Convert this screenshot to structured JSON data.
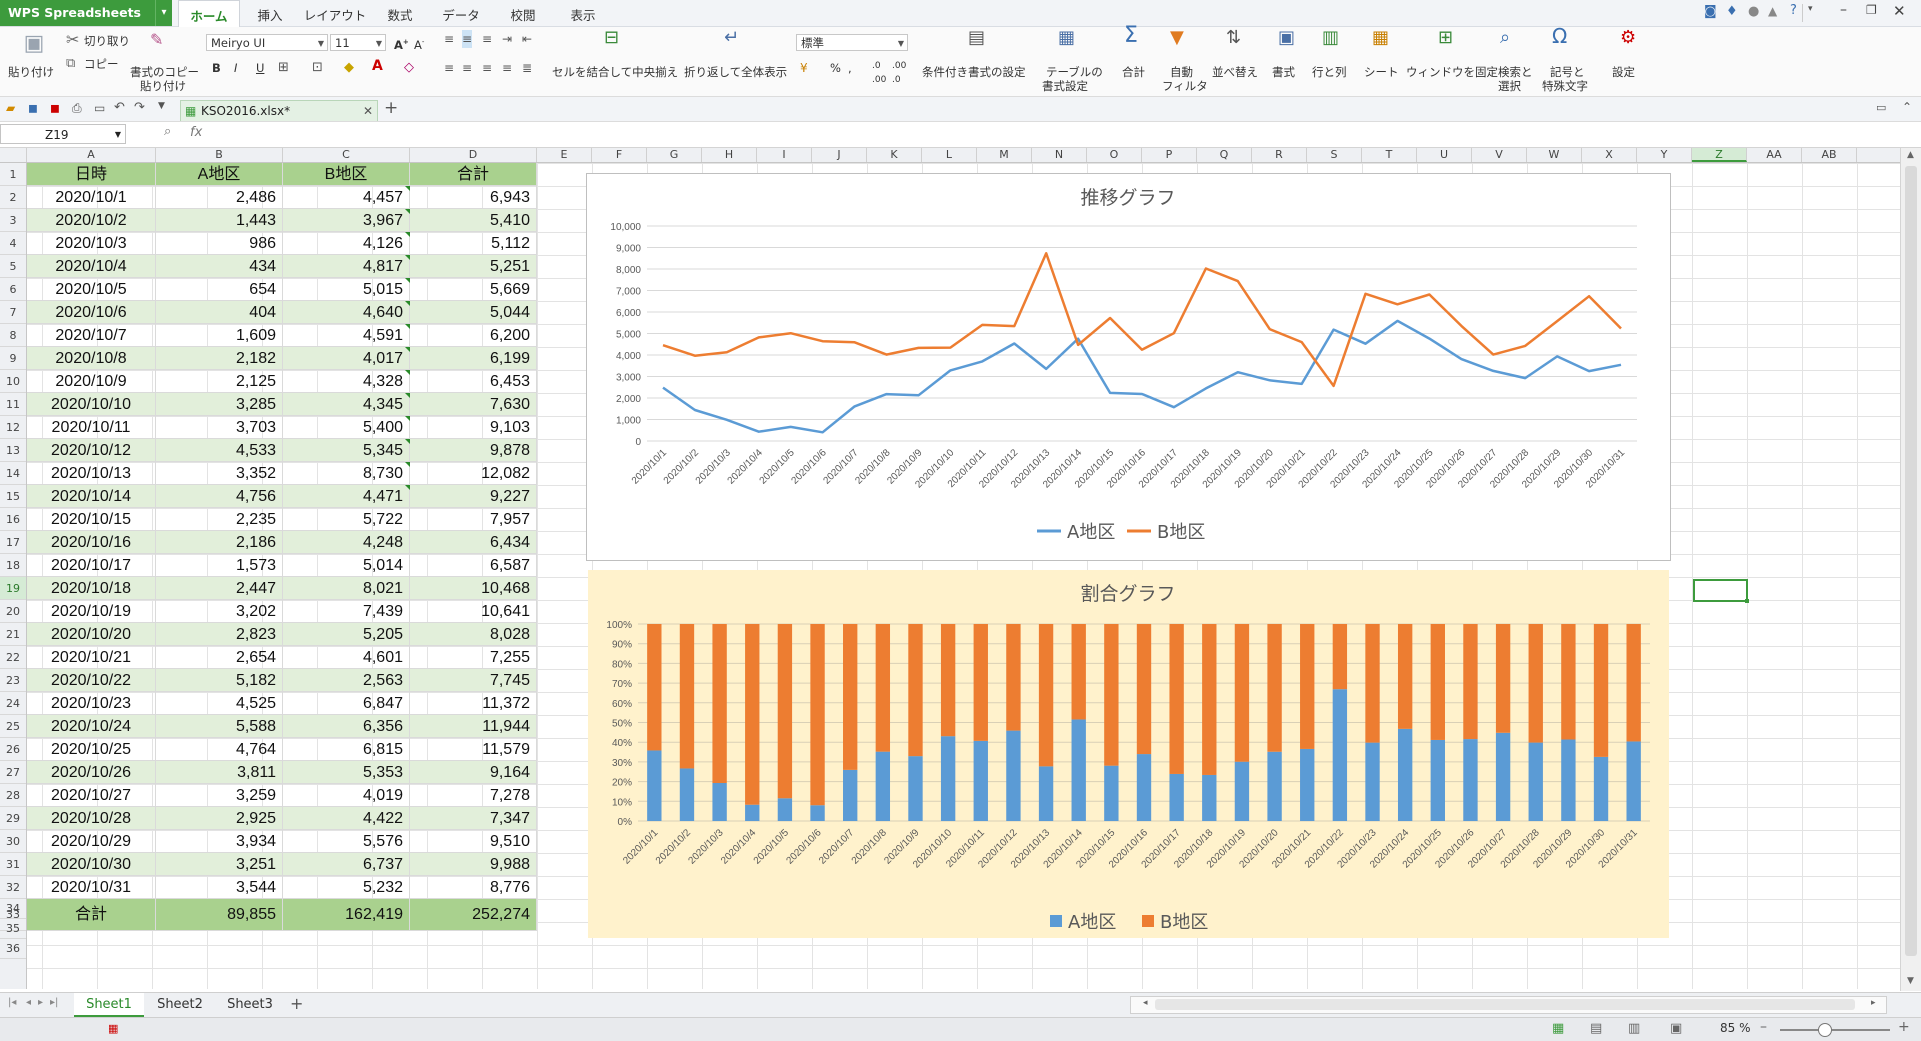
{
  "app": {
    "name": "WPS Spreadsheets"
  },
  "menu_tabs": [
    "ホーム",
    "挿入",
    "レイアウト",
    "数式",
    "データ",
    "校閲",
    "表示"
  ],
  "ribbon": {
    "paste": "貼り付け",
    "cut": "切り取り",
    "copy": "コピー",
    "format_painter_1": "書式のコピー",
    "format_painter_2": "貼り付け",
    "font_name": "Meiryo UI",
    "font_size": "11",
    "bold": "B",
    "italic": "I",
    "underline": "U",
    "number_format": "標準",
    "merge_center": "セルを結合して中央揃え",
    "wrap_text": "折り返して全体表示",
    "cond_format": "条件付き書式の設定",
    "table_format_1": "テーブルの",
    "table_format_2": "書式設定",
    "sum": "合計",
    "auto_filter_1": "自動",
    "auto_filter_2": "フィルタ",
    "sort": "並べ替え",
    "format": "書式",
    "row_col": "行と列",
    "sheet": "シート",
    "freeze": "ウィンドウを固定",
    "find_1": "検索と",
    "find_2": "選択",
    "symbol_1": "記号と",
    "symbol_2": "特殊文字",
    "settings": "設定"
  },
  "document_tab": "KSO2016.xlsx*",
  "name_box": "Z19",
  "fx": "fx",
  "columns": [
    "A",
    "B",
    "C",
    "D",
    "E",
    "F",
    "G",
    "H",
    "I",
    "J",
    "K",
    "L",
    "M",
    "N",
    "O",
    "P",
    "Q",
    "R",
    "S",
    "T",
    "U",
    "V",
    "W",
    "X",
    "Y",
    "Z",
    "AA",
    "AB"
  ],
  "table": {
    "headers": [
      "日時",
      "A地区",
      "B地区",
      "合計"
    ],
    "rows": [
      [
        "2020/10/1",
        "2,486",
        "4,457",
        "6,943"
      ],
      [
        "2020/10/2",
        "1,443",
        "3,967",
        "5,410"
      ],
      [
        "2020/10/3",
        "986",
        "4,126",
        "5,112"
      ],
      [
        "2020/10/4",
        "434",
        "4,817",
        "5,251"
      ],
      [
        "2020/10/5",
        "654",
        "5,015",
        "5,669"
      ],
      [
        "2020/10/6",
        "404",
        "4,640",
        "5,044"
      ],
      [
        "2020/10/7",
        "1,609",
        "4,591",
        "6,200"
      ],
      [
        "2020/10/8",
        "2,182",
        "4,017",
        "6,199"
      ],
      [
        "2020/10/9",
        "2,125",
        "4,328",
        "6,453"
      ],
      [
        "2020/10/10",
        "3,285",
        "4,345",
        "7,630"
      ],
      [
        "2020/10/11",
        "3,703",
        "5,400",
        "9,103"
      ],
      [
        "2020/10/12",
        "4,533",
        "5,345",
        "9,878"
      ],
      [
        "2020/10/13",
        "3,352",
        "8,730",
        "12,082"
      ],
      [
        "2020/10/14",
        "4,756",
        "4,471",
        "9,227"
      ],
      [
        "2020/10/15",
        "2,235",
        "5,722",
        "7,957"
      ],
      [
        "2020/10/16",
        "2,186",
        "4,248",
        "6,434"
      ],
      [
        "2020/10/17",
        "1,573",
        "5,014",
        "6,587"
      ],
      [
        "2020/10/18",
        "2,447",
        "8,021",
        "10,468"
      ],
      [
        "2020/10/19",
        "3,202",
        "7,439",
        "10,641"
      ],
      [
        "2020/10/20",
        "2,823",
        "5,205",
        "8,028"
      ],
      [
        "2020/10/21",
        "2,654",
        "4,601",
        "7,255"
      ],
      [
        "2020/10/22",
        "5,182",
        "2,563",
        "7,745"
      ],
      [
        "2020/10/23",
        "4,525",
        "6,847",
        "11,372"
      ],
      [
        "2020/10/24",
        "5,588",
        "6,356",
        "11,944"
      ],
      [
        "2020/10/25",
        "4,764",
        "6,815",
        "11,579"
      ],
      [
        "2020/10/26",
        "3,811",
        "5,353",
        "9,164"
      ],
      [
        "2020/10/27",
        "3,259",
        "4,019",
        "7,278"
      ],
      [
        "2020/10/28",
        "2,925",
        "4,422",
        "7,347"
      ],
      [
        "2020/10/29",
        "3,934",
        "5,576",
        "9,510"
      ],
      [
        "2020/10/30",
        "3,251",
        "6,737",
        "9,988"
      ],
      [
        "2020/10/31",
        "3,544",
        "5,232",
        "8,776"
      ]
    ],
    "total": [
      "合計",
      "89,855",
      "162,419",
      "252,274"
    ]
  },
  "sheets": [
    "Sheet1",
    "Sheet2",
    "Sheet3"
  ],
  "add_sheet": "+",
  "zoom": "85 %",
  "chart_data": [
    {
      "type": "line",
      "title": "推移グラフ",
      "categories": [
        "2020/10/1",
        "2020/10/2",
        "2020/10/3",
        "2020/10/4",
        "2020/10/5",
        "2020/10/6",
        "2020/10/7",
        "2020/10/8",
        "2020/10/9",
        "2020/10/10",
        "2020/10/11",
        "2020/10/12",
        "2020/10/13",
        "2020/10/14",
        "2020/10/15",
        "2020/10/16",
        "2020/10/17",
        "2020/10/18",
        "2020/10/19",
        "2020/10/20",
        "2020/10/21",
        "2020/10/22",
        "2020/10/23",
        "2020/10/24",
        "2020/10/25",
        "2020/10/26",
        "2020/10/27",
        "2020/10/28",
        "2020/10/29",
        "2020/10/30",
        "2020/10/31"
      ],
      "series": [
        {
          "name": "A地区",
          "color": "#5b9bd5",
          "values": [
            2486,
            1443,
            986,
            434,
            654,
            404,
            1609,
            2182,
            2125,
            3285,
            3703,
            4533,
            3352,
            4756,
            2235,
            2186,
            1573,
            2447,
            3202,
            2823,
            2654,
            5182,
            4525,
            5588,
            4764,
            3811,
            3259,
            2925,
            3934,
            3251,
            3544
          ]
        },
        {
          "name": "B地区",
          "color": "#ed7d31",
          "values": [
            4457,
            3967,
            4126,
            4817,
            5015,
            4640,
            4591,
            4017,
            4328,
            4345,
            5400,
            5345,
            8730,
            4471,
            5722,
            4248,
            5014,
            8021,
            7439,
            5205,
            4601,
            2563,
            6847,
            6356,
            6815,
            5353,
            4019,
            4422,
            5576,
            6737,
            5232
          ]
        }
      ],
      "ylim": [
        0,
        10000
      ],
      "yticks": [
        "0",
        "1,000",
        "2,000",
        "3,000",
        "4,000",
        "5,000",
        "6,000",
        "7,000",
        "8,000",
        "9,000",
        "10,000"
      ],
      "grid": true,
      "legend": "bottom"
    },
    {
      "type": "bar",
      "stacked": "percent",
      "title": "割合グラフ",
      "categories": [
        "2020/10/1",
        "2020/10/2",
        "2020/10/3",
        "2020/10/4",
        "2020/10/5",
        "2020/10/6",
        "2020/10/7",
        "2020/10/8",
        "2020/10/9",
        "2020/10/10",
        "2020/10/11",
        "2020/10/12",
        "2020/10/13",
        "2020/10/14",
        "2020/10/15",
        "2020/10/16",
        "2020/10/17",
        "2020/10/18",
        "2020/10/19",
        "2020/10/20",
        "2020/10/21",
        "2020/10/22",
        "2020/10/23",
        "2020/10/24",
        "2020/10/25",
        "2020/10/26",
        "2020/10/27",
        "2020/10/28",
        "2020/10/29",
        "2020/10/30",
        "2020/10/31"
      ],
      "series": [
        {
          "name": "A地区",
          "color": "#5b9bd5",
          "values": [
            2486,
            1443,
            986,
            434,
            654,
            404,
            1609,
            2182,
            2125,
            3285,
            3703,
            4533,
            3352,
            4756,
            2235,
            2186,
            1573,
            2447,
            3202,
            2823,
            2654,
            5182,
            4525,
            5588,
            4764,
            3811,
            3259,
            2925,
            3934,
            3251,
            3544
          ]
        },
        {
          "name": "B地区",
          "color": "#ed7d31",
          "values": [
            4457,
            3967,
            4126,
            4817,
            5015,
            4640,
            4591,
            4017,
            4328,
            4345,
            5400,
            5345,
            8730,
            4471,
            5722,
            4248,
            5014,
            8021,
            7439,
            5205,
            4601,
            2563,
            6847,
            6356,
            6815,
            5353,
            4019,
            4422,
            5576,
            6737,
            5232
          ]
        }
      ],
      "ylim": [
        0,
        100
      ],
      "yticks": [
        "0%",
        "10%",
        "20%",
        "30%",
        "40%",
        "50%",
        "60%",
        "70%",
        "80%",
        "90%",
        "100%"
      ],
      "background": "#fff2cc",
      "grid": true,
      "legend": "bottom"
    }
  ]
}
